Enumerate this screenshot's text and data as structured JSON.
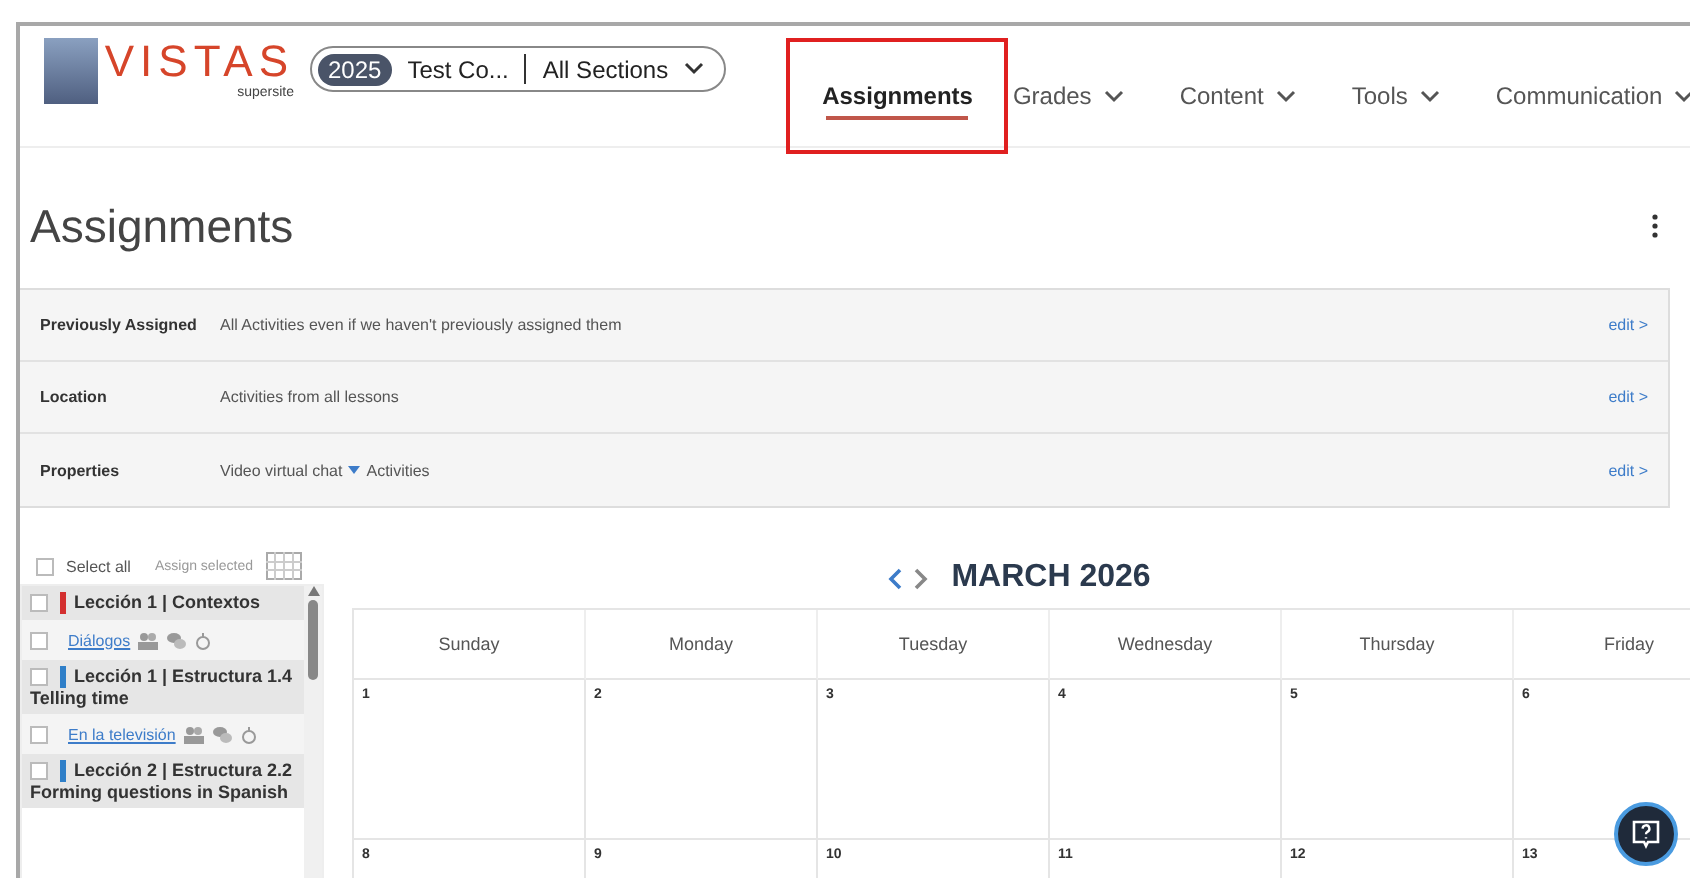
{
  "header": {
    "brand": "VISTAS",
    "brand_sub": "supersite",
    "course": {
      "year": "2025",
      "name": "Test Co...",
      "section": "All Sections"
    },
    "nav": [
      {
        "label": "Assignments",
        "selected": true,
        "dropdown": false,
        "highlighted": true
      },
      {
        "label": "Grades",
        "selected": false,
        "dropdown": true,
        "highlighted": false
      },
      {
        "label": "Content",
        "selected": false,
        "dropdown": true,
        "highlighted": false
      },
      {
        "label": "Tools",
        "selected": false,
        "dropdown": true,
        "highlighted": false
      },
      {
        "label": "Communication",
        "selected": false,
        "dropdown": true,
        "highlighted": false
      }
    ]
  },
  "page_title": "Assignments",
  "filters": [
    {
      "label": "Previously Assigned",
      "value": "All Activities even if we haven't previously assigned them",
      "dropdown": false,
      "action": "edit >"
    },
    {
      "label": "Location",
      "value": "Activities from all lessons",
      "dropdown": false,
      "action": "edit >"
    },
    {
      "label": "Properties",
      "value": "Video virtual chat",
      "dropdown": true,
      "extra": "Activities",
      "action": "edit >"
    }
  ],
  "list": {
    "select_all": "Select all",
    "select_all_checked": false,
    "assign_selected": "Assign selected",
    "items": [
      {
        "kind": "section",
        "title": "Lección 1 | Contextos",
        "color": "#d32f2f",
        "checked": false
      },
      {
        "kind": "activity",
        "title": "Diálogos",
        "checked": false
      },
      {
        "kind": "section",
        "title": "Lección 1 | Estructura 1.4",
        "subtitle": "Telling time",
        "color": "#2f7fc8",
        "checked": false
      },
      {
        "kind": "activity",
        "title": "En la televisión",
        "checked": false
      },
      {
        "kind": "section",
        "title": "Lección 2 | Estructura 2.2",
        "subtitle": "Forming questions in Spanish",
        "color": "#2f7fc8",
        "checked": false
      }
    ]
  },
  "calendar": {
    "month": "MARCH 2026",
    "weekdays": [
      "Sunday",
      "Monday",
      "Tuesday",
      "Wednesday",
      "Thursday",
      "Friday"
    ],
    "weeks": [
      [
        "1",
        "2",
        "3",
        "4",
        "5",
        "6"
      ],
      [
        "8",
        "9",
        "10",
        "11",
        "12",
        "13"
      ]
    ]
  }
}
